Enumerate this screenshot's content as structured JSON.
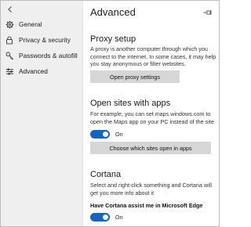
{
  "sidebar": {
    "items": [
      {
        "label": "General",
        "icon": "gear-icon"
      },
      {
        "label": "Privacy & security",
        "icon": "lock-icon"
      },
      {
        "label": "Passwords & autofill",
        "icon": "key-icon"
      },
      {
        "label": "Advanced",
        "icon": "sliders-icon"
      }
    ],
    "active": "Advanced"
  },
  "main": {
    "title": "Advanced",
    "proxy": {
      "title": "Proxy setup",
      "description": "A proxy is another computer through which you connect to the internet. In some cases, it may help you stay anonymous or filter websites.",
      "button": "Open proxy settings"
    },
    "open_sites": {
      "title": "Open sites with apps",
      "description": "For example, you can set maps.windows.com to open the Maps app on your PC instead of the site",
      "toggle_label": "On",
      "toggle_on": true,
      "button": "Choose which sites open in apps"
    },
    "cortana": {
      "title": "Cortana",
      "description": "Select and right-click something and Cortana will get you more info about it",
      "setting_label": "Have Cortana assist me in Microsoft Edge",
      "toggle_label": "On",
      "toggle_on": true
    }
  },
  "colors": {
    "accent": "#1565c0",
    "sidebar_bg": "#efefef",
    "button_bg": "#d6d6d6"
  }
}
